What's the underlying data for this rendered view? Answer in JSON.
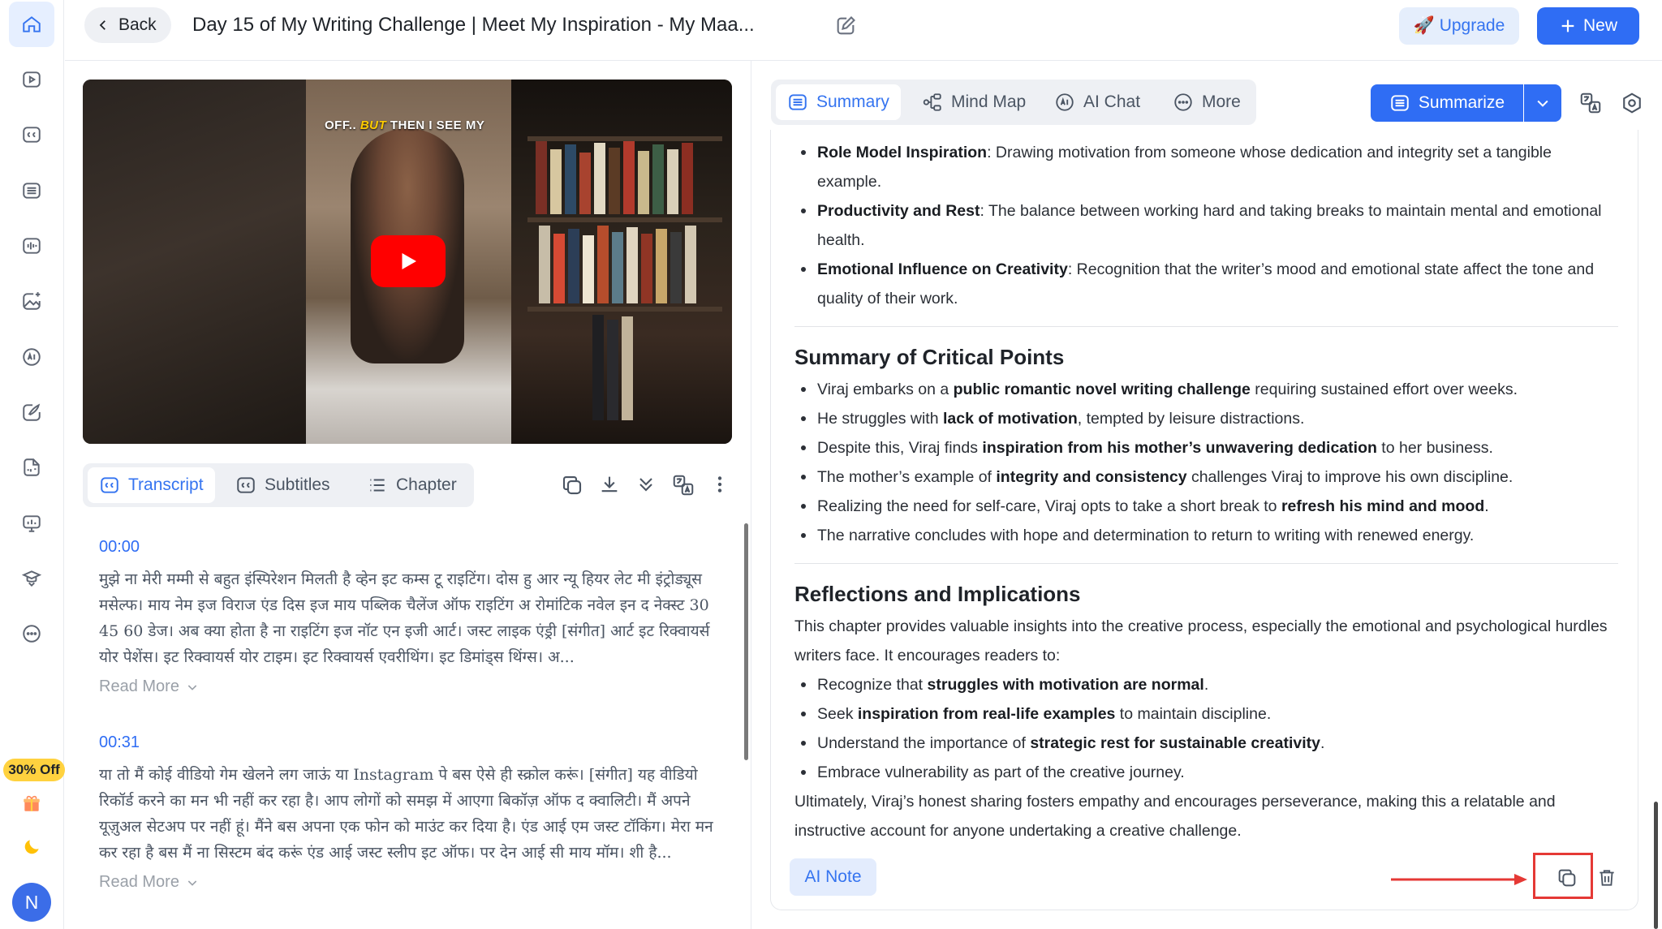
{
  "sidebar": {
    "icons": [
      "home-icon",
      "video-icon",
      "subtitles-icon",
      "list-icon",
      "audio-icon",
      "image-sparkle-icon",
      "ai-icon",
      "pen-icon",
      "pdf-icon",
      "slides-icon",
      "graduation-icon",
      "more-icon"
    ],
    "promo_label": "30% Off",
    "avatar_initial": "N"
  },
  "header": {
    "back_label": "Back",
    "title": "Day 15 of My Writing Challenge | Meet My Inspiration - My Maa...",
    "upgrade_label": "🚀 Upgrade",
    "new_label": "New"
  },
  "video": {
    "caption_pre": "OFF.. ",
    "caption_em": "BUT",
    "caption_post": " THEN I SEE MY"
  },
  "left_tabs": [
    {
      "label": "Transcript",
      "icon": "cc-icon",
      "active": true
    },
    {
      "label": "Subtitles",
      "icon": "cc-icon",
      "active": false
    },
    {
      "label": "Chapter",
      "icon": "list-icon",
      "active": false
    }
  ],
  "transcript": [
    {
      "time": "00:00",
      "text": "मुझे ना मेरी मम्मी से बहुत इंस्पिरेशन मिलती है व्हेन इट कम्स टू राइटिंग। दोस हु आर न्यू हियर लेट मी इंट्रोड्यूस मसेल्फ। माय नेम इज विराज एंड दिस इज माय पब्लिक चैलेंज ऑफ राइटिंग अ रोमांटिक नवेल इन द नेक्स्ट 30 45 60 डेज। अब क्या होता है ना राइटिंग इज नॉट एन इजी आर्ट। जस्ट लाइक एंड्री [संगीत] आर्ट इट रिक्वायर्स योर पेशेंस। इट रिक्वायर्स योर टाइम। इट रिक्वायर्स एवरीथिंग। इट डिमांड्स थिंग्स। अ...",
      "read_more": "Read More"
    },
    {
      "time": "00:31",
      "text": "या तो मैं कोई वीडियो गेम खेलने लग जाऊं या Instagram पे बस ऐसे ही स्क्रोल करूं। [संगीत] यह वीडियो रिकॉर्ड करने का मन भी नहीं कर रहा है। आप लोगों को समझ में आएगा बिकॉज़ ऑफ द क्वालिटी। मैं अपने यूज़ुअल सेटअप पर नहीं हूं। मैंने बस अपना एक फोन को माउंट कर दिया है। एंड आई एम जस्ट टॉकिंग। मेरा मन कर रहा है बस मैं ना सिस्टम बंद करूं एंड आई जस्ट स्लीप इट ऑफ। पर देन आई सी माय मॉम। शी है...",
      "read_more": "Read More"
    }
  ],
  "right_tabs": [
    {
      "label": "Summary",
      "icon": "doc-icon",
      "active": true
    },
    {
      "label": "Mind Map",
      "icon": "mindmap-icon",
      "active": false
    },
    {
      "label": "AI Chat",
      "icon": "ai-icon",
      "active": false
    },
    {
      "label": "More",
      "icon": "more-icon",
      "active": false
    }
  ],
  "summarize_label": "Summarize",
  "summary": {
    "top_bullets": [
      {
        "bold": "Role Model Inspiration",
        "rest": ": Drawing motivation from someone whose dedication and integrity set a tangible example."
      },
      {
        "bold": "Productivity and Rest",
        "rest": ": The balance between working hard and taking breaks to maintain mental and emotional health."
      },
      {
        "bold": "Emotional Influence on Creativity",
        "rest": ": Recognition that the writer’s mood and emotional state affect the tone and quality of their work."
      }
    ],
    "critical_heading": "Summary of Critical Points",
    "critical_bullets": [
      {
        "pre": "Viraj embarks on a ",
        "bold": "public romantic novel writing challenge",
        "post": " requiring sustained effort over weeks."
      },
      {
        "pre": "He struggles with ",
        "bold": "lack of motivation",
        "post": ", tempted by leisure distractions."
      },
      {
        "pre": "Despite this, Viraj finds ",
        "bold": "inspiration from his mother’s unwavering dedication",
        "post": " to her business."
      },
      {
        "pre": "The mother’s example of ",
        "bold": "integrity and consistency",
        "post": " challenges Viraj to improve his own discipline."
      },
      {
        "pre": "Realizing the need for self-care, Viraj opts to take a short break to ",
        "bold": "refresh his mind and mood",
        "post": "."
      },
      {
        "pre": "The narrative concludes with hope and determination to return to writing with renewed energy.",
        "bold": "",
        "post": ""
      }
    ],
    "reflections_heading": "Reflections and Implications",
    "reflections_intro": "This chapter provides valuable insights into the creative process, especially the emotional and psychological hurdles writers face. It encourages readers to:",
    "reflection_bullets": [
      {
        "pre": "Recognize that ",
        "bold": "struggles with motivation are normal",
        "post": "."
      },
      {
        "pre": "Seek ",
        "bold": "inspiration from real-life examples",
        "post": " to maintain discipline."
      },
      {
        "pre": "Understand the importance of ",
        "bold": "strategic rest for sustainable creativity",
        "post": "."
      },
      {
        "pre": "Embrace vulnerability as part of the creative journey.",
        "bold": "",
        "post": ""
      }
    ],
    "closing": "Ultimately, Viraj’s honest sharing fosters empathy and encourages perseverance, making this a relatable and instructive account for anyone undertaking a creative challenge."
  },
  "ai_note_label": "AI Note",
  "colors": {
    "accent": "#2f6df4",
    "highlight": "#e53935",
    "promo": "#ffd23f",
    "play": "#ff0000"
  }
}
